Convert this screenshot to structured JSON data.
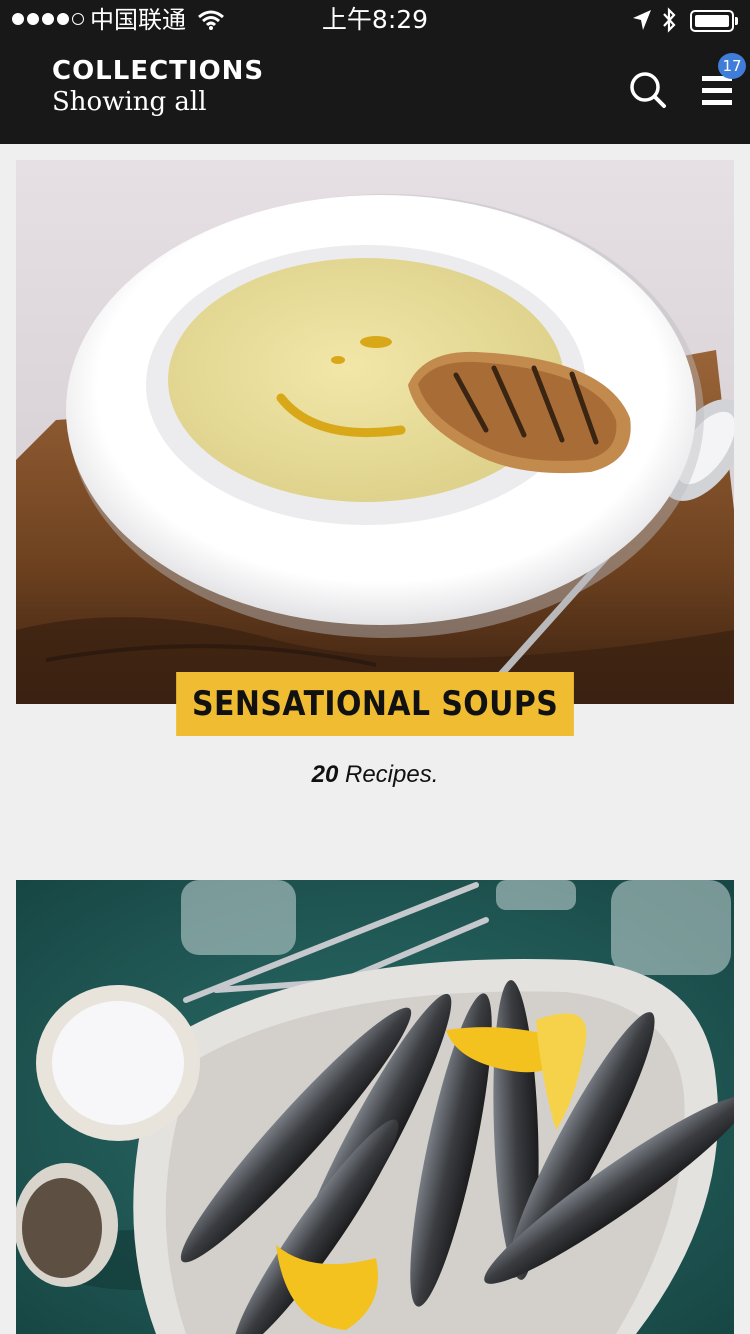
{
  "status_bar": {
    "carrier": "中国联通",
    "time": "上午8:29"
  },
  "header": {
    "title": "COLLECTIONS",
    "subtitle": "Showing all",
    "badge_count": "17"
  },
  "collections": [
    {
      "title": "SENSATIONAL SOUPS",
      "recipe_count": "20",
      "recipe_suffix": " Recipes."
    },
    {
      "title": "",
      "recipe_count": "",
      "recipe_suffix": ""
    }
  ],
  "colors": {
    "header_bg": "#181818",
    "label_bg": "#f0bd32",
    "badge_bg": "#3f7dd8",
    "page_bg": "#efefef"
  },
  "icons": [
    "signal-icon",
    "wifi-icon",
    "location-icon",
    "bluetooth-icon",
    "battery-icon",
    "search-icon",
    "menu-icon"
  ]
}
